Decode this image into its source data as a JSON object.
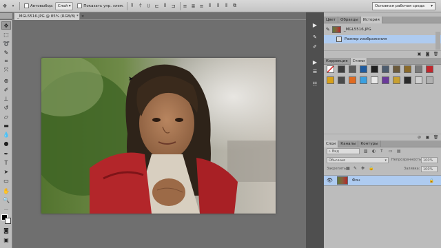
{
  "options_bar": {
    "autoselect_label": "Автовыбор:",
    "autoselect_value": "Слой",
    "show_controls_label": "Показать упр. элем.",
    "workspace": "Основная рабочая среда"
  },
  "document": {
    "tab_title": "_MGL5516.JPG @ 85% (RGB/8) *"
  },
  "history_panel": {
    "tabs": [
      "Цвет",
      "Образцы",
      "История"
    ],
    "active_tab": "История",
    "snapshot_label": "_MGL5516.JPG",
    "step_label": "Размер изображения"
  },
  "styles_panel": {
    "tabs": [
      "Коррекция",
      "Стили"
    ],
    "active_tab": "Стили"
  },
  "layers_panel": {
    "tabs": [
      "Слои",
      "Каналы",
      "Контуры"
    ],
    "active_tab": "Слои",
    "kind_placeholder": "Вид",
    "blend_mode": "Обычные",
    "opacity_label": "Непрозрачность:",
    "opacity_value": "100%",
    "lock_label": "Закрепить:",
    "fill_label": "Заливка:",
    "fill_value": "100%",
    "layer_name": "Фон"
  },
  "colors": {
    "accent_selection": "#aecbf0",
    "panel_bg": "#bcbcbc",
    "dock_bg": "#4f4f4f"
  }
}
